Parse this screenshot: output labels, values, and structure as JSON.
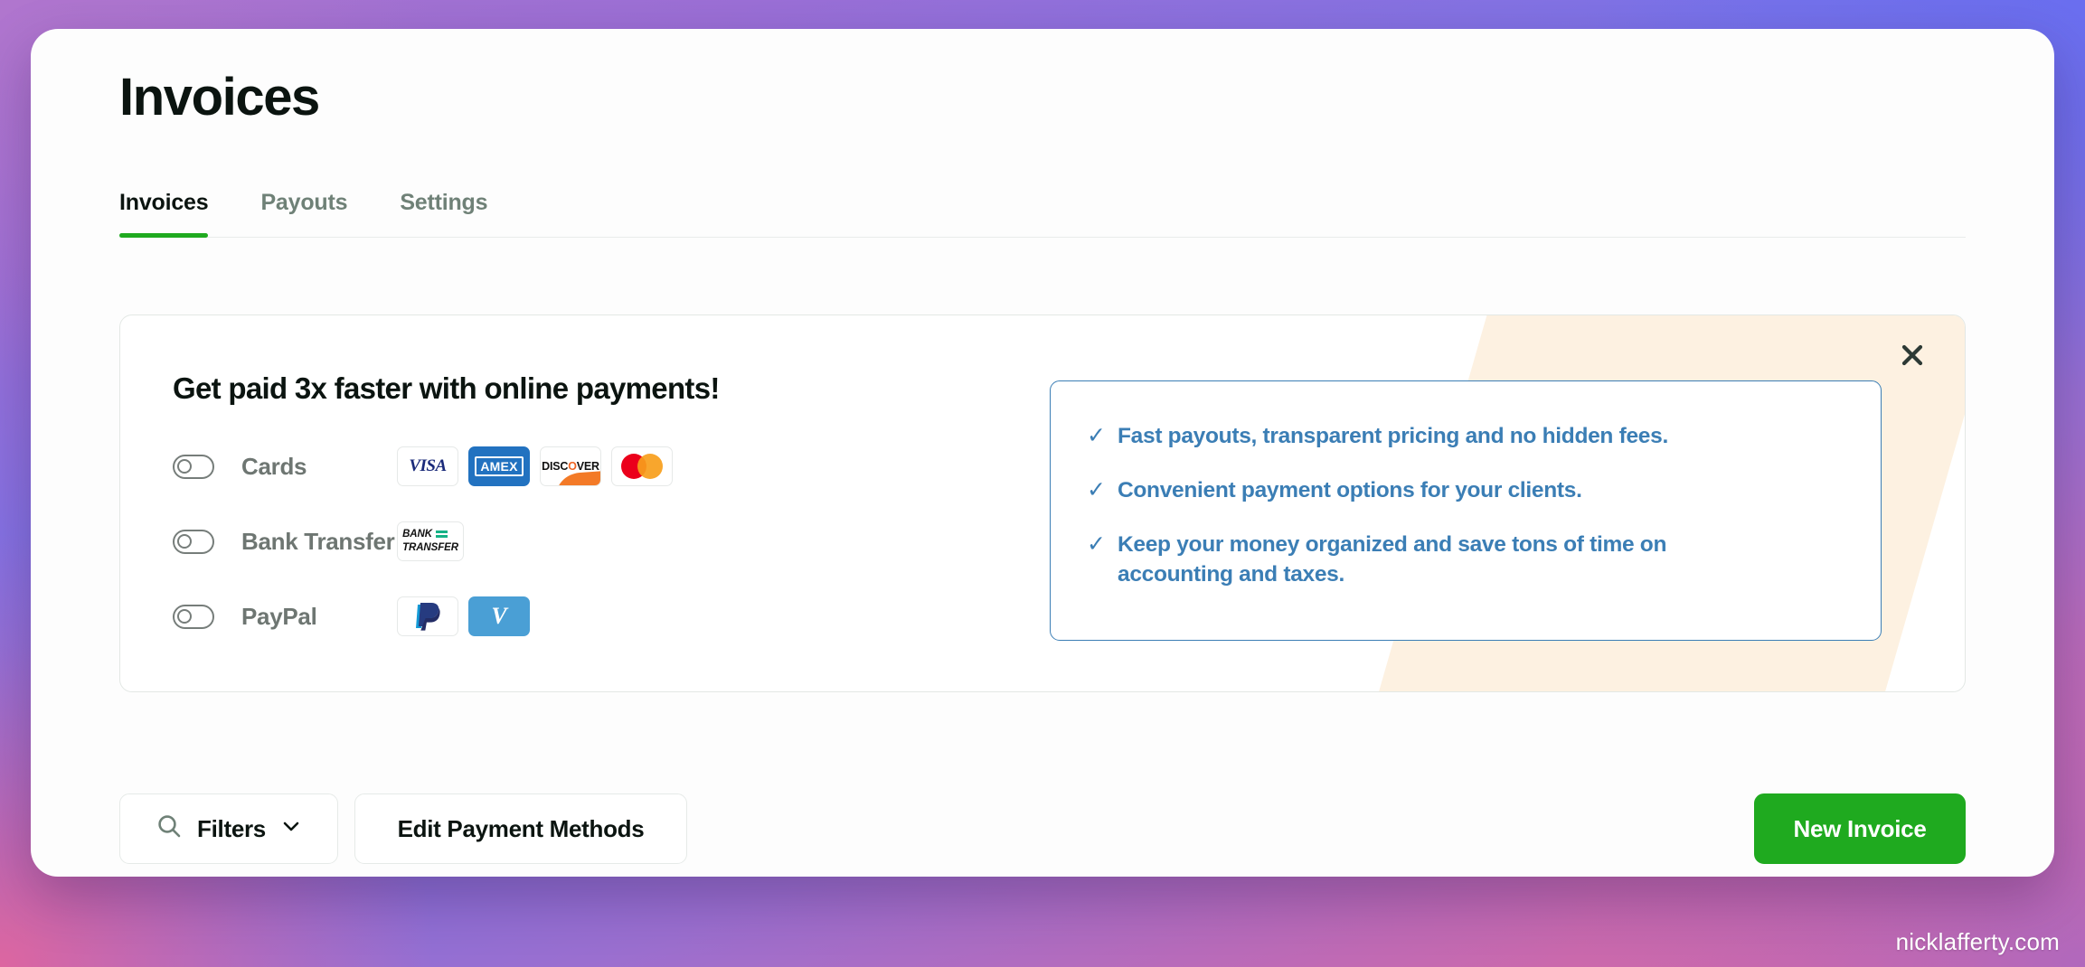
{
  "page": {
    "title": "Invoices",
    "watermark": "nicklafferty.com"
  },
  "tabs": [
    {
      "label": "Invoices",
      "active": true
    },
    {
      "label": "Payouts",
      "active": false
    },
    {
      "label": "Settings",
      "active": false
    }
  ],
  "promo": {
    "heading": "Get paid 3x faster with online payments!",
    "close_icon": "close-icon",
    "methods": [
      {
        "label": "Cards",
        "enabled": false,
        "logos": [
          "VISA",
          "AMEX",
          "DISCOVER",
          "mastercard"
        ]
      },
      {
        "label": "Bank Transfer",
        "enabled": false,
        "logos": [
          "BANK TRANSFER"
        ]
      },
      {
        "label": "PayPal",
        "enabled": false,
        "logos": [
          "PayPal",
          "Venmo"
        ]
      }
    ],
    "bank_logo": {
      "line1": "BANK",
      "line2": "TRANSFER"
    },
    "venmo_letter": "V",
    "benefits": [
      "Fast payouts, transparent pricing and no hidden fees.",
      "Convenient payment options for your clients.",
      "Keep your money organized and save tons of time on accounting and taxes."
    ],
    "check_glyph": "✓"
  },
  "toolbar": {
    "filters_label": "Filters",
    "filters_icon": "search-icon",
    "filters_chevron": "chevron-down-icon",
    "edit_payment_methods_label": "Edit Payment Methods",
    "new_invoice_label": "New Invoice"
  },
  "colors": {
    "accent_green": "#1faa1f",
    "benefit_blue": "#3b7eb5",
    "promo_deco": "#fdf1e1",
    "muted_tab": "#6f8177"
  }
}
